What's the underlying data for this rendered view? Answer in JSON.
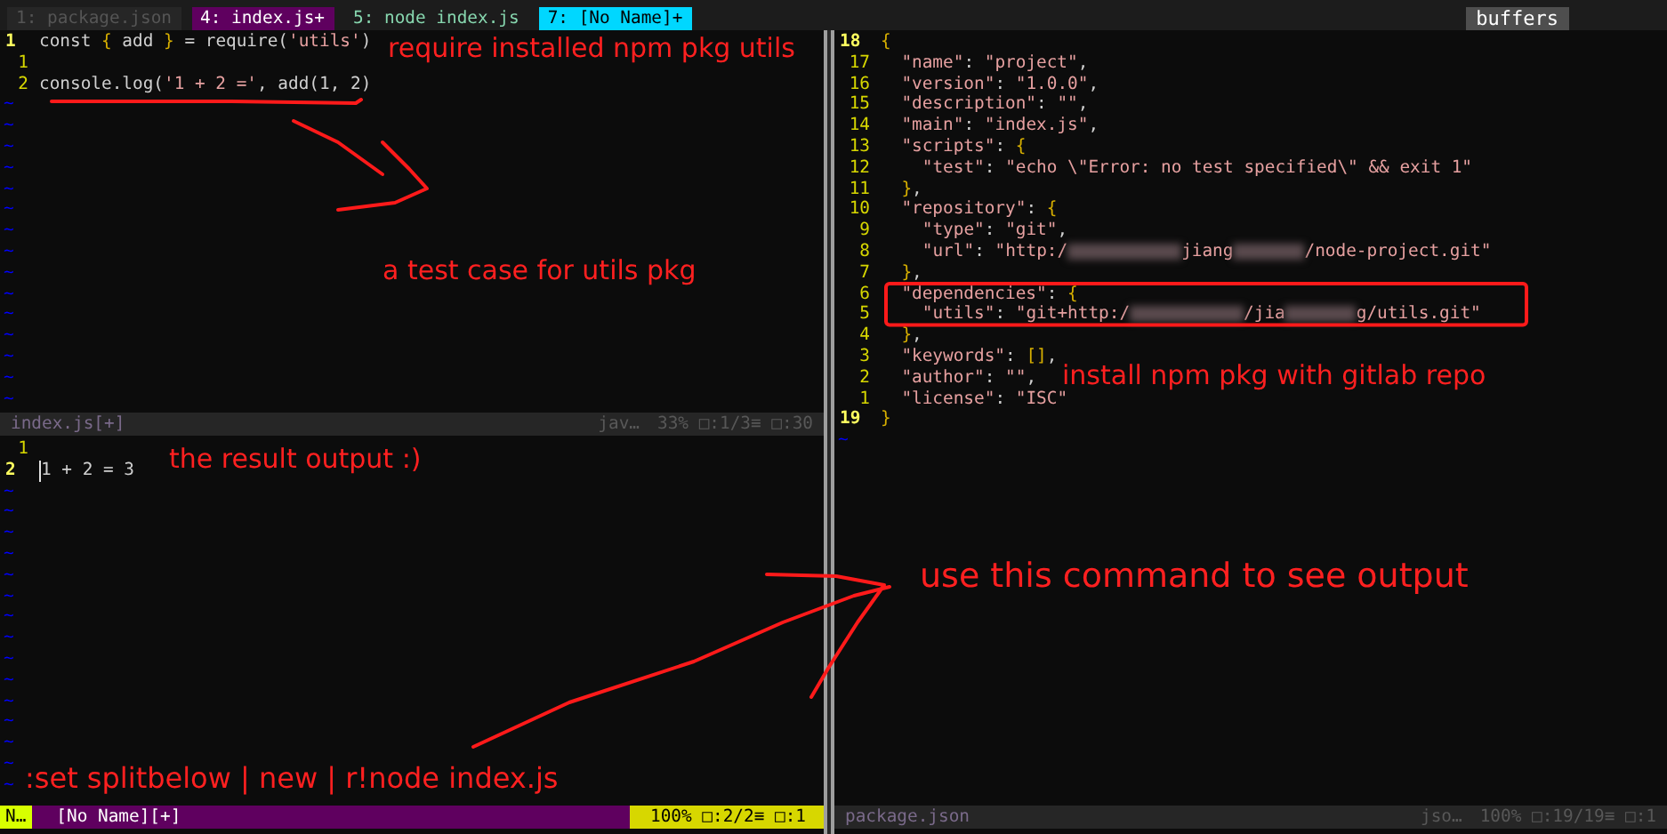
{
  "tabline": {
    "tabs": [
      {
        "label": "1: package.json",
        "kind": "hidden",
        "selected": false
      },
      {
        "label": "4: index.js+",
        "kind": "buffer",
        "selected": true
      },
      {
        "label": "5: node index.js",
        "kind": "terminal",
        "selected": false
      },
      {
        "label": "7: [No Name]+",
        "kind": "buffer",
        "selected": false
      }
    ],
    "right_label": "buffers"
  },
  "left_top": {
    "lines": [
      {
        "number": "1",
        "current": true,
        "kind": "flat",
        "tokens": [
          {
            "kind": "text",
            "text": "const "
          },
          {
            "kind": "brace",
            "text": "{"
          },
          {
            "kind": "text",
            "text": " add "
          },
          {
            "kind": "brace",
            "text": "}"
          },
          {
            "kind": "text",
            "text": " = require("
          },
          {
            "kind": "str",
            "text": "'utils'"
          },
          {
            "kind": "text",
            "text": ")"
          }
        ]
      },
      {
        "number": "1",
        "current": false
      },
      {
        "number": "2",
        "current": false,
        "kind": "flat",
        "tokens": [
          {
            "kind": "text",
            "text": "console.log("
          },
          {
            "kind": "str",
            "text": "'1 + 2 ='"
          },
          {
            "kind": "text",
            "text": ", add(1, 2)"
          }
        ]
      }
    ],
    "filler": [
      "~",
      "~",
      "~",
      "~",
      "~",
      "~",
      "~",
      "~",
      "~",
      "~",
      "~",
      "~",
      "~",
      "~",
      "~"
    ],
    "status": {
      "file": "index.js[+]",
      "filetype": "jav…",
      "position": "33% □:1/3≡ □:30"
    }
  },
  "left_bottom": {
    "lines": [
      {
        "number": "1",
        "current": false
      },
      {
        "number": "2",
        "current": true,
        "cursor": true,
        "kind": "flat",
        "tokens": [
          {
            "kind": "text",
            "text": "1 + 2 = 3"
          }
        ]
      }
    ],
    "filler": [
      "~",
      "~",
      "~",
      "~",
      "~",
      "~",
      "~",
      "~",
      "~",
      "~",
      "~",
      "~",
      "~",
      "~",
      "~"
    ],
    "status": {
      "mode": "N…",
      "file": "[No Name][+]",
      "position": "100% □:2/2≡ □:1"
    }
  },
  "right": {
    "lines": [
      {
        "number": "18",
        "current": true,
        "kind": "flat",
        "tokens": [
          {
            "kind": "brace",
            "text": "{"
          }
        ]
      },
      {
        "number": "17",
        "current": false,
        "kind": "indent1",
        "tokens": [
          {
            "kind": "str",
            "text": "\"name\""
          },
          {
            "kind": "text",
            "text": ": "
          },
          {
            "kind": "str",
            "text": "\"project\""
          },
          {
            "kind": "text",
            "text": ","
          }
        ]
      },
      {
        "number": "16",
        "current": false,
        "kind": "indent1",
        "tokens": [
          {
            "kind": "str",
            "text": "\"version\""
          },
          {
            "kind": "text",
            "text": ": "
          },
          {
            "kind": "str",
            "text": "\"1.0.0\""
          },
          {
            "kind": "text",
            "text": ","
          }
        ]
      },
      {
        "number": "15",
        "current": false,
        "kind": "indent1",
        "tokens": [
          {
            "kind": "str",
            "text": "\"description\""
          },
          {
            "kind": "text",
            "text": ": "
          },
          {
            "kind": "str",
            "text": "\"\""
          },
          {
            "kind": "text",
            "text": ","
          }
        ]
      },
      {
        "number": "14",
        "current": false,
        "kind": "indent1",
        "tokens": [
          {
            "kind": "str",
            "text": "\"main\""
          },
          {
            "kind": "text",
            "text": ": "
          },
          {
            "kind": "str",
            "text": "\"index.js\""
          },
          {
            "kind": "text",
            "text": ","
          }
        ]
      },
      {
        "number": "13",
        "current": false,
        "kind": "indent1",
        "tokens": [
          {
            "kind": "str",
            "text": "\"scripts\""
          },
          {
            "kind": "text",
            "text": ": "
          },
          {
            "kind": "brace",
            "text": "{"
          }
        ]
      },
      {
        "number": "12",
        "current": false,
        "kind": "indent2",
        "tokens": [
          {
            "kind": "str",
            "text": "\"test\""
          },
          {
            "kind": "text",
            "text": ": "
          },
          {
            "kind": "str",
            "text": "\"echo \\\"Error: no test specified\\\" && exit 1\""
          }
        ]
      },
      {
        "number": "11",
        "current": false,
        "kind": "indent1",
        "tokens": [
          {
            "kind": "brace",
            "text": "}"
          },
          {
            "kind": "text",
            "text": ","
          }
        ]
      },
      {
        "number": "10",
        "current": false,
        "kind": "indent1",
        "tokens": [
          {
            "kind": "str",
            "text": "\"repository\""
          },
          {
            "kind": "text",
            "text": ": "
          },
          {
            "kind": "brace",
            "text": "{"
          }
        ]
      },
      {
        "number": "9",
        "current": false,
        "kind": "indent2",
        "tokens": [
          {
            "kind": "str",
            "text": "\"type\""
          },
          {
            "kind": "text",
            "text": ": "
          },
          {
            "kind": "str",
            "text": "\"git\""
          },
          {
            "kind": "text",
            "text": ","
          }
        ]
      },
      {
        "number": "8",
        "current": false,
        "kind": "indent2",
        "tokens": [
          {
            "kind": "str",
            "text": "\"url\""
          },
          {
            "kind": "text",
            "text": ": "
          },
          {
            "kind": "str",
            "text": "\"http:/"
          },
          {
            "kind": "blur_wide"
          },
          {
            "kind": "str",
            "text": "jiang"
          },
          {
            "kind": "blur_narrow"
          },
          {
            "kind": "str",
            "text": "/node-project.git\""
          }
        ]
      },
      {
        "number": "7",
        "current": false,
        "kind": "indent1",
        "tokens": [
          {
            "kind": "brace",
            "text": "}"
          },
          {
            "kind": "text",
            "text": ","
          }
        ]
      },
      {
        "number": "6",
        "current": false,
        "kind": "indent1",
        "tokens": [
          {
            "kind": "str",
            "text": "\"dependencies\""
          },
          {
            "kind": "text",
            "text": ": "
          },
          {
            "kind": "brace",
            "text": "{"
          }
        ]
      },
      {
        "number": "5",
        "current": false,
        "kind": "indent2",
        "tokens": [
          {
            "kind": "str",
            "text": "\"utils\""
          },
          {
            "kind": "text",
            "text": ": "
          },
          {
            "kind": "str",
            "text": "\"git+http:/"
          },
          {
            "kind": "blur_wide"
          },
          {
            "kind": "str",
            "text": "/jia"
          },
          {
            "kind": "blur_narrow"
          },
          {
            "kind": "str",
            "text": "g/utils.git\""
          }
        ]
      },
      {
        "number": "4",
        "current": false,
        "kind": "indent1",
        "tokens": [
          {
            "kind": "brace",
            "text": "}"
          },
          {
            "kind": "text",
            "text": ","
          }
        ]
      },
      {
        "number": "3",
        "current": false,
        "kind": "indent1",
        "tokens": [
          {
            "kind": "str",
            "text": "\"keywords\""
          },
          {
            "kind": "text",
            "text": ": "
          },
          {
            "kind": "brace",
            "text": "[]"
          },
          {
            "kind": "text",
            "text": ","
          }
        ]
      },
      {
        "number": "2",
        "current": false,
        "kind": "indent1",
        "tokens": [
          {
            "kind": "str",
            "text": "\"author\""
          },
          {
            "kind": "text",
            "text": ": "
          },
          {
            "kind": "str",
            "text": "\"\""
          },
          {
            "kind": "text",
            "text": ","
          }
        ]
      },
      {
        "number": "1",
        "current": false,
        "kind": "indent1",
        "tokens": [
          {
            "kind": "str",
            "text": "\"license\""
          },
          {
            "kind": "text",
            "text": ": "
          },
          {
            "kind": "str",
            "text": "\"ISC\""
          }
        ]
      },
      {
        "number": "19",
        "current": true,
        "kind": "flat",
        "tokens": [
          {
            "kind": "brace",
            "text": "}"
          }
        ]
      }
    ],
    "filler": [
      "~"
    ],
    "status": {
      "file": "package.json",
      "filetype": "jso…",
      "position": "100% □:19/19≡ □:1"
    }
  },
  "annotations": [
    {
      "text": "require installed npm pkg utils"
    },
    {
      "text": "a test  case for utils pkg"
    },
    {
      "text": "the result output :)"
    },
    {
      "text": "install npm pkg with gitlab repo"
    },
    {
      "text": "use this command to see output"
    },
    {
      "text": ":set splitbelow | new | r!node index.js"
    }
  ]
}
